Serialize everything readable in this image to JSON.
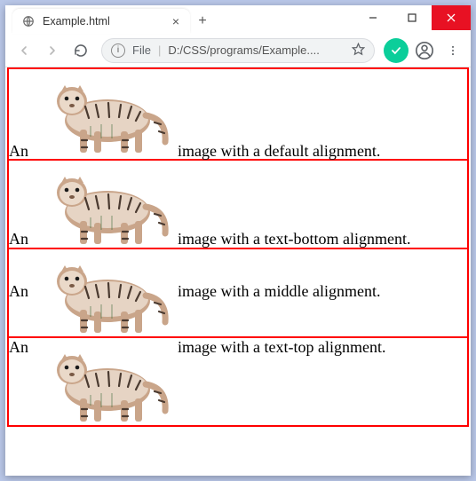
{
  "window": {
    "tab_title": "Example.html",
    "address_label": "File",
    "address_path": "D:/CSS/programs/Example....",
    "new_tab": "+",
    "close_tab": "×"
  },
  "rows": [
    {
      "prefix": "An",
      "suffix": "image with a default alignment."
    },
    {
      "prefix": "An",
      "suffix": "image with a text-bottom alignment."
    },
    {
      "prefix": "An",
      "suffix": "image with a middle alignment."
    },
    {
      "prefix": "An",
      "suffix": "image with a text-top alignment."
    }
  ]
}
